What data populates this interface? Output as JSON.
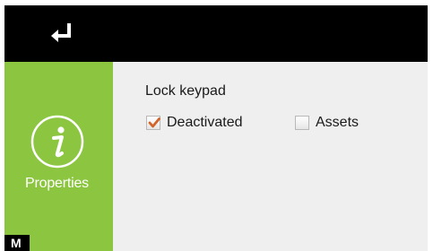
{
  "topbar": {
    "back_icon": "return-arrow-icon"
  },
  "sidebar": {
    "icon": "info-icon",
    "label": "Properties",
    "accent_color": "#8cc641"
  },
  "mode_badge": {
    "label": "M"
  },
  "main": {
    "section_title": "Lock keypad",
    "options": [
      {
        "label": "Deactivated",
        "checked": true
      },
      {
        "label": "Assets",
        "checked": false
      }
    ],
    "check_color": "#d2642a"
  }
}
